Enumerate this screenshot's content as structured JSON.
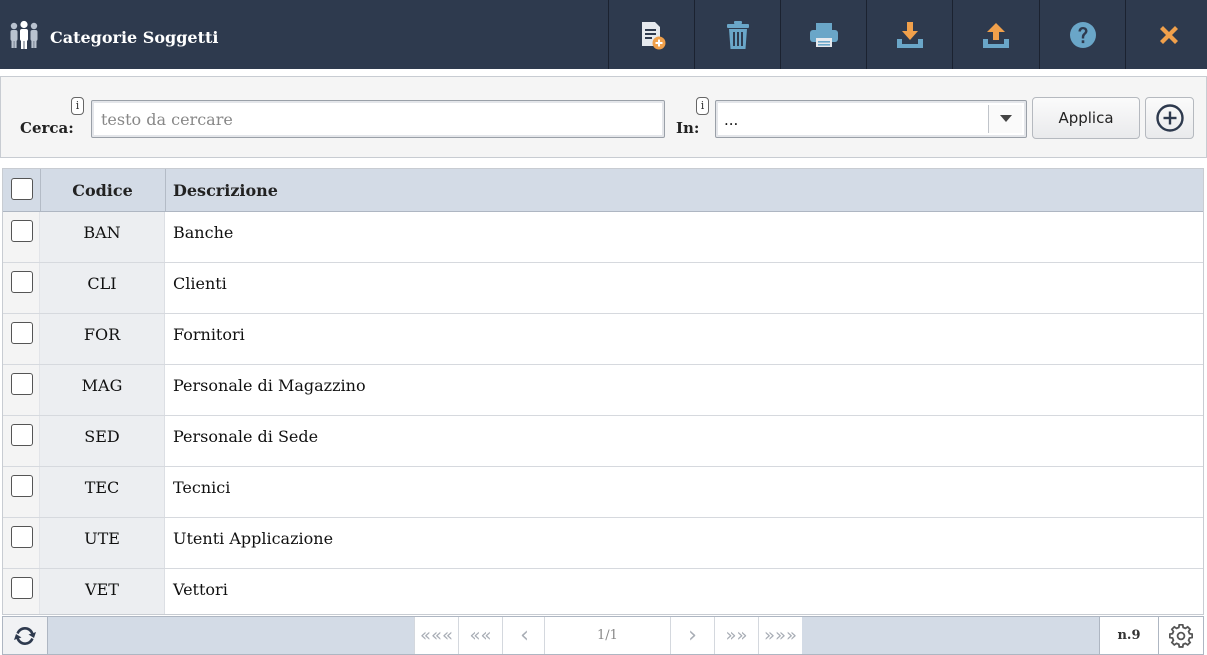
{
  "header": {
    "title": "Categorie Soggetti",
    "app_icon": "people-icon",
    "background": "#2e3a4e",
    "toolbar": [
      {
        "name": "new-document-button",
        "icon": "new-document-icon"
      },
      {
        "name": "delete-button",
        "icon": "trash-icon"
      },
      {
        "name": "print-button",
        "icon": "printer-icon"
      },
      {
        "name": "download-button",
        "icon": "download-icon"
      },
      {
        "name": "upload-button",
        "icon": "upload-icon"
      },
      {
        "name": "help-button",
        "icon": "help-icon"
      },
      {
        "name": "close-button",
        "icon": "close-icon"
      }
    ]
  },
  "search": {
    "label": "Cerca:",
    "placeholder": "testo da cercare",
    "value": "",
    "info": "i",
    "in_label": "In:",
    "in_info": "i",
    "in_value": "...",
    "apply_label": "Applica"
  },
  "table": {
    "columns": [
      "Codice",
      "Descrizione"
    ],
    "rows": [
      {
        "code": "BAN",
        "description": "Banche"
      },
      {
        "code": "CLI",
        "description": "Clienti"
      },
      {
        "code": "FOR",
        "description": "Fornitori"
      },
      {
        "code": "MAG",
        "description": "Personale di Magazzino"
      },
      {
        "code": "SED",
        "description": "Personale di Sede"
      },
      {
        "code": "TEC",
        "description": "Tecnici"
      },
      {
        "code": "UTE",
        "description": "Utenti Applicazione"
      },
      {
        "code": "VET",
        "description": "Vettori"
      }
    ]
  },
  "pager": {
    "first": "«««",
    "prev_block": "««",
    "prev": "‹",
    "page": "1/1",
    "next": "›",
    "next_block": "»»",
    "last": "»»»",
    "count": "n.9"
  },
  "colors": {
    "accent_orange": "#f0a04b",
    "icon_light": "#e6e9ee",
    "icon_blue": "#6aa6c8",
    "header_row": "#d3dbe6"
  }
}
